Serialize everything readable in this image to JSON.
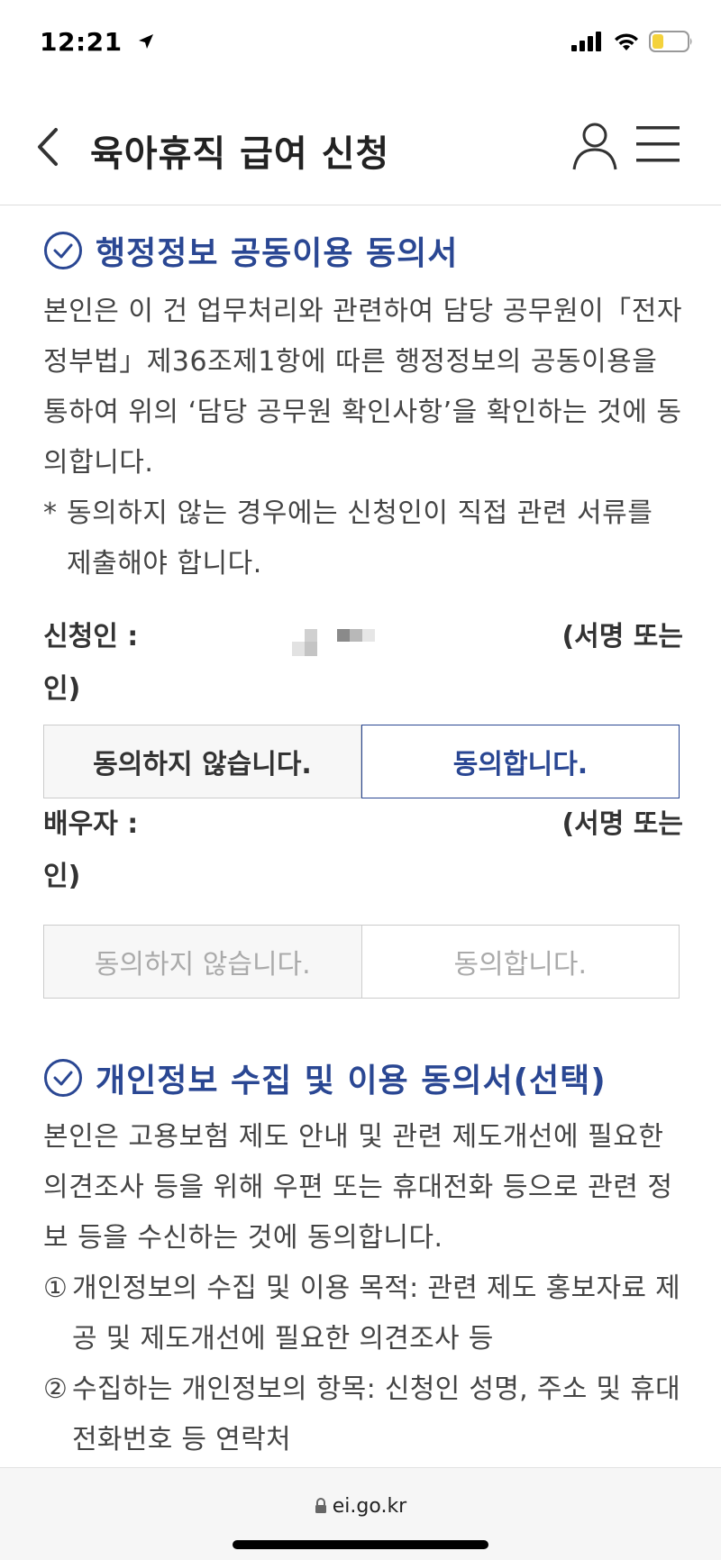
{
  "status_bar": {
    "time": "12:21"
  },
  "header": {
    "title": "육아휴직 급여 신청"
  },
  "section1": {
    "title": "행정정보 공동이용 동의서",
    "body": "본인은 이 건 업무처리와 관련하여 담당 공무원이「전자정부법」제36조제1항에 따른 행정정보의 공동이용을 통하여 위의 ‘담당 공무원 확인사항’을 확인하는 것에 동의합니다.",
    "note_mark": "*",
    "note": "동의하지 않는 경우에는 신청인이 직접 관련 서류를 제출해야 합니다.",
    "applicant": {
      "label": "신청인 :",
      "seal_label": "(서명 또는",
      "seal_cont": "인)",
      "btn_disagree": "동의하지 않습니다.",
      "btn_agree": "동의합니다."
    },
    "spouse": {
      "label": "배우자 :",
      "seal_label": "(서명 또는",
      "seal_cont": "인)",
      "btn_disagree": "동의하지 않습니다.",
      "btn_agree": "동의합니다."
    }
  },
  "section2": {
    "title": "개인정보 수집 및 이용 동의서(선택)",
    "body": "본인은 고용보험 제도 안내 및 관련 제도개선에 필요한 의견조사 등을 위해 우편 또는 휴대전화 등으로 관련 정보 등을 수신하는 것에 동의합니다.",
    "items": [
      {
        "num": "①",
        "text": "개인정보의 수집 및 이용 목적: 관련 제도 홍보자료 제공 및 제도개선에 필요한 의견조사 등"
      },
      {
        "num": "②",
        "text": "수집하는 개인정보의 항목: 신청인 성명, 주소 및 휴대전화번호 등 연락처"
      }
    ]
  },
  "url_bar": {
    "url": "ei.go.kr"
  },
  "colors": {
    "accent": "#2a4793",
    "text": "#444444",
    "border": "#cccccc"
  },
  "icons": [
    "location-arrow-icon",
    "signal-icon",
    "wifi-icon",
    "battery-icon",
    "back-chevron-icon",
    "user-icon",
    "menu-icon",
    "check-circle-icon",
    "lock-icon"
  ]
}
